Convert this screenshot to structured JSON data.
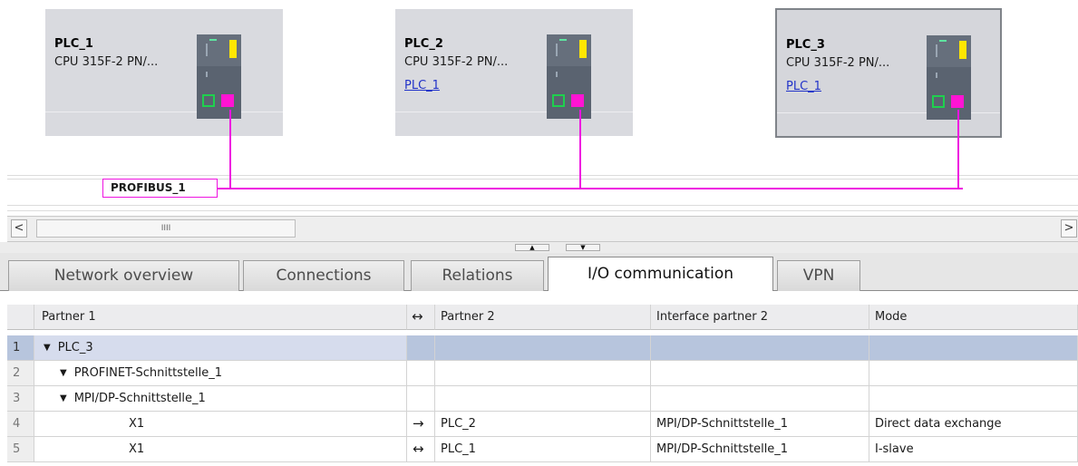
{
  "devices": [
    {
      "name": "PLC_1",
      "cpu": "CPU 315F-2 PN/...",
      "link": ""
    },
    {
      "name": "PLC_2",
      "cpu": "CPU 315F-2 PN/...",
      "link": "PLC_1"
    },
    {
      "name": "PLC_3",
      "cpu": "CPU 315F-2 PN/...",
      "link": "PLC_1"
    }
  ],
  "bus": {
    "label": "PROFIBUS_1",
    "color": "#ee13e0"
  },
  "scrollbar": {
    "left_arrow": "<",
    "right_arrow": ">",
    "thumb_grip": "IIII"
  },
  "splitter": {
    "up": "▲",
    "down": "▼"
  },
  "tabs": [
    "Network overview",
    "Connections",
    "Relations",
    "I/O communication",
    "VPN"
  ],
  "active_tab": "I/O communication",
  "table": {
    "headers": {
      "partner1": "Partner 1",
      "dir": "↔",
      "partner2": "Partner 2",
      "iface": "Interface partner 2",
      "mode": "Mode"
    },
    "rows": [
      {
        "num": "1",
        "p1": "PLC_3",
        "dir": "",
        "p2": "",
        "iface": "",
        "mode": ""
      },
      {
        "num": "2",
        "p1": "PROFINET-Schnittstelle_1",
        "dir": "",
        "p2": "",
        "iface": "",
        "mode": ""
      },
      {
        "num": "3",
        "p1": "MPI/DP-Schnittstelle_1",
        "dir": "",
        "p2": "",
        "iface": "",
        "mode": ""
      },
      {
        "num": "4",
        "p1": "X1",
        "dir": "→",
        "p2": "PLC_2",
        "iface": "MPI/DP-Schnittstelle_1",
        "mode": "Direct data exchange"
      },
      {
        "num": "5",
        "p1": "X1",
        "dir": "↔",
        "p2": "PLC_1",
        "iface": "MPI/DP-Schnittstelle_1",
        "mode": "I-slave"
      }
    ],
    "caret": "▼"
  }
}
